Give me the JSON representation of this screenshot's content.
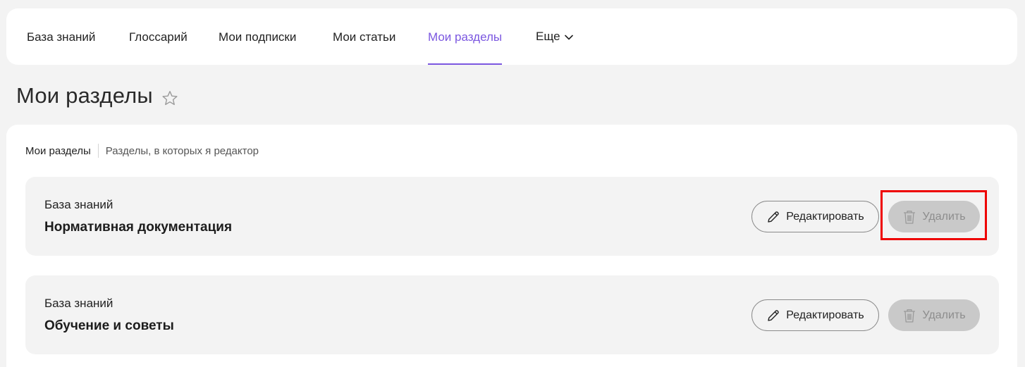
{
  "nav": {
    "items": [
      {
        "label": "База знаний"
      },
      {
        "label": "Глоссарий"
      },
      {
        "label": "Мои подписки"
      },
      {
        "label": "Мои статьи"
      },
      {
        "label": "Мои разделы"
      },
      {
        "label": "Еще"
      }
    ],
    "active_index": 4,
    "more_icon": "chevron-down-icon"
  },
  "page": {
    "title": "Мои разделы",
    "favorite_icon": "star-outline-icon"
  },
  "subtabs": [
    {
      "label": "Мои разделы"
    },
    {
      "label": "Разделы, в которых я редактор"
    }
  ],
  "sections": [
    {
      "knowledge_base": "База знаний",
      "name": "Нормативная документация",
      "edit_label": "Редактировать",
      "delete_label": "Удалить",
      "delete_disabled": true
    },
    {
      "knowledge_base": "База знаний",
      "name": "Обучение и советы",
      "edit_label": "Редактировать",
      "delete_label": "Удалить",
      "delete_disabled": true
    }
  ],
  "colors": {
    "accent": "#7b57e0",
    "highlight": "#ee0000",
    "disabled_bg": "#c9c9c9"
  }
}
